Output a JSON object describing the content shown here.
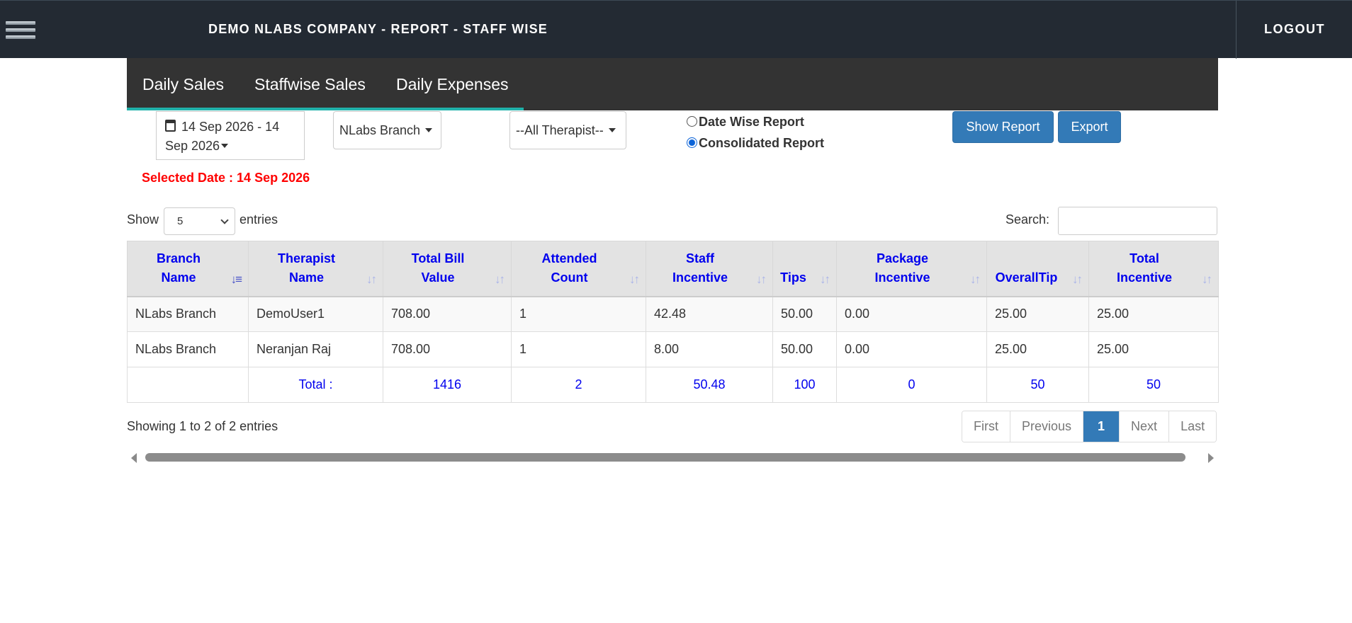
{
  "header": {
    "title": "DEMO NLABS COMPANY - REPORT - STAFF WISE",
    "logout_label": "LOGOUT"
  },
  "tabs": [
    {
      "label": "Daily Sales"
    },
    {
      "label": "Staffwise Sales"
    },
    {
      "label": "Daily Expenses"
    }
  ],
  "filters": {
    "date_range_line1": "14 Sep 2026 - 14",
    "date_range_line2": "Sep 2026",
    "branch": "NLabs Branch",
    "therapist": "--All Therapist--",
    "report_options": [
      {
        "label": "Date Wise Report",
        "selected": false
      },
      {
        "label": "Consolidated Report",
        "selected": true
      }
    ],
    "show_report_label": "Show Report",
    "export_label": "Export",
    "selected_date_text": "Selected Date : 14 Sep 2026"
  },
  "list_controls": {
    "show_label": "Show",
    "entries_value": "5",
    "entries_label": "entries",
    "search_label": "Search:",
    "search_value": ""
  },
  "table": {
    "columns": [
      {
        "line1": "Branch",
        "line2": "Name"
      },
      {
        "line1": "Therapist",
        "line2": "Name"
      },
      {
        "line1": "Total Bill",
        "line2": "Value"
      },
      {
        "line1": "Attended",
        "line2": "Count"
      },
      {
        "line1": "Staff",
        "line2": "Incentive"
      },
      {
        "line1": "",
        "line2": "Tips"
      },
      {
        "line1": "Package",
        "line2": "Incentive"
      },
      {
        "line1": "",
        "line2": "OverallTip"
      },
      {
        "line1": "Total",
        "line2": "Incentive"
      }
    ],
    "rows": [
      [
        "NLabs Branch",
        "DemoUser1",
        "708.00",
        "1",
        "42.48",
        "50.00",
        "0.00",
        "25.00",
        "25.00"
      ],
      [
        "NLabs Branch",
        "Neranjan Raj",
        "708.00",
        "1",
        "8.00",
        "50.00",
        "0.00",
        "25.00",
        "25.00"
      ]
    ],
    "totals": [
      "",
      "Total :",
      "1416",
      "2",
      "50.48",
      "100",
      "0",
      "50",
      "50"
    ]
  },
  "footer": {
    "info": "Showing 1 to 2 of 2 entries",
    "pagination": {
      "first": "First",
      "previous": "Previous",
      "current": "1",
      "next": "Next",
      "last": "Last"
    }
  },
  "colors": {
    "topbar": "#232a33",
    "tabbar": "#333333",
    "tab_accent": "#20b2aa",
    "primary_button": "#337ab7",
    "header_text": "#0000ee",
    "selected_date": "#ff0000"
  },
  "icons": {
    "menu": "hamburger-icon",
    "date": "calendar-icon",
    "sort": "sort-arrows-icon"
  }
}
